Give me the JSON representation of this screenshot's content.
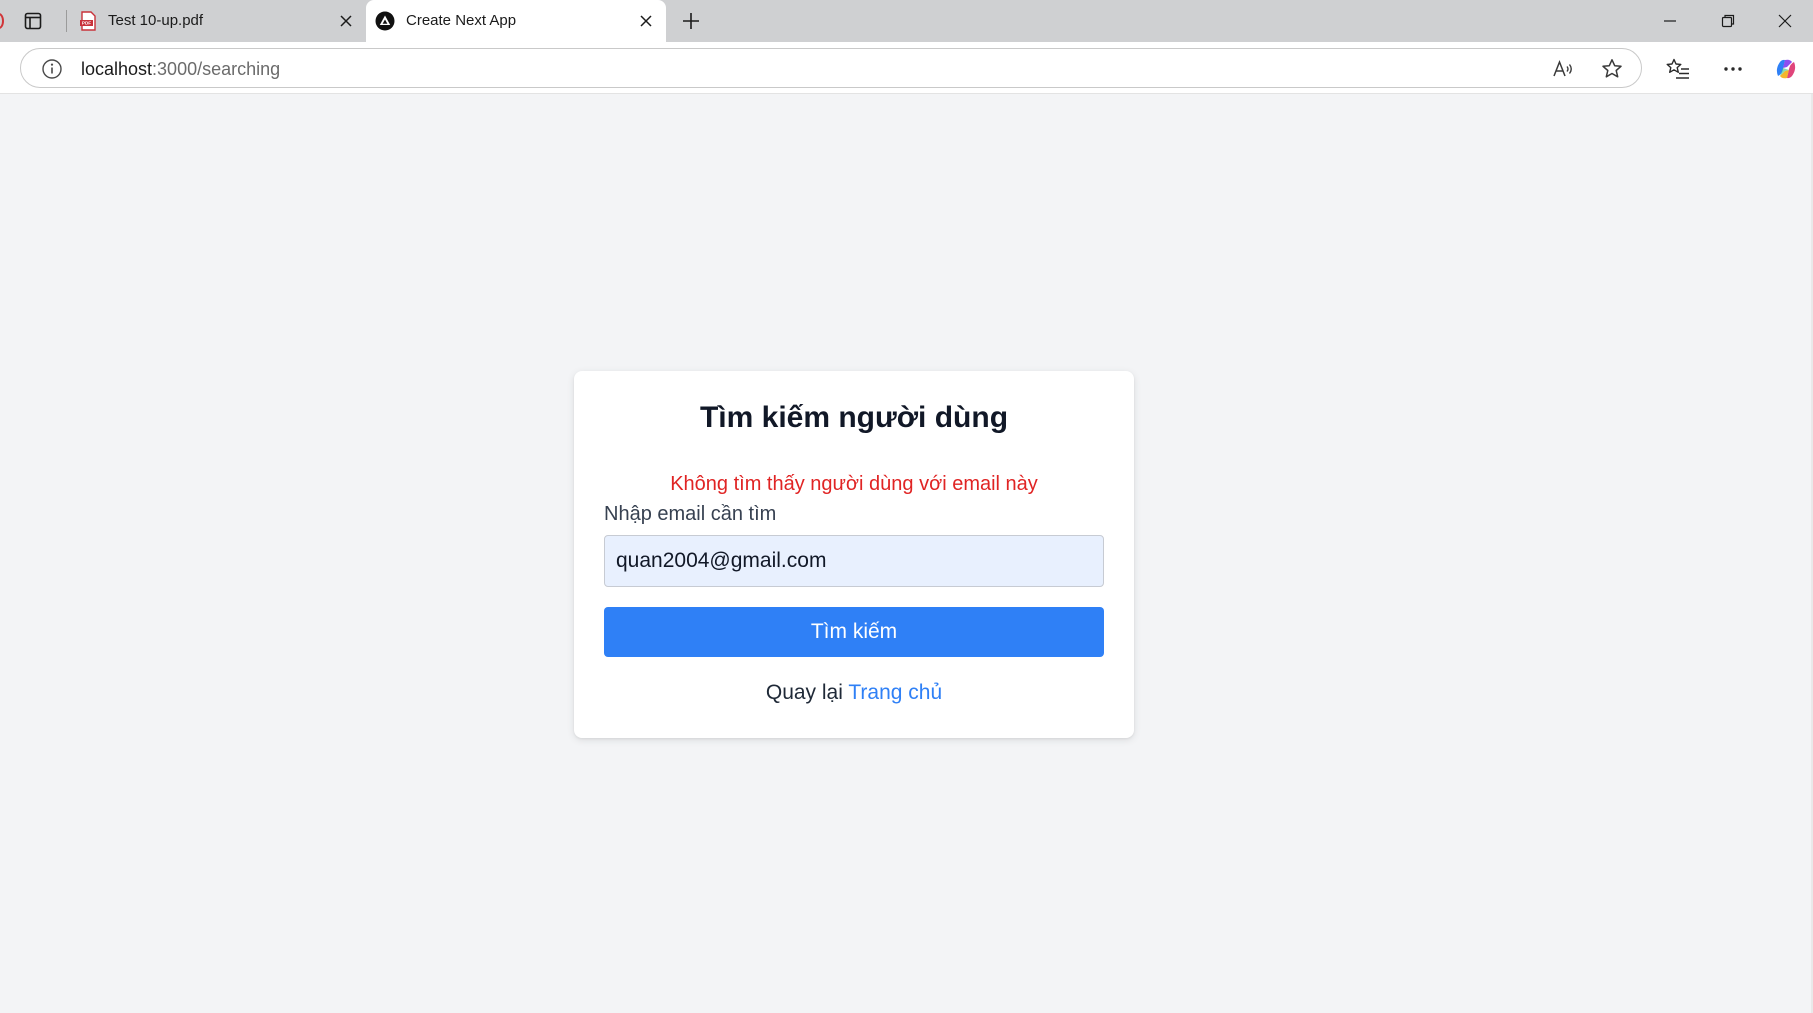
{
  "browser": {
    "tabs": [
      {
        "title": "Test 10-up.pdf",
        "icon": "pdf-icon",
        "active": false
      },
      {
        "title": "Create Next App",
        "icon": "nextjs-icon",
        "active": true
      }
    ],
    "address": {
      "host": "localhost",
      "rest": ":3000/searching"
    }
  },
  "page": {
    "title": "Tìm kiếm người dùng",
    "error": "Không tìm thấy người dùng với email này",
    "email_label": "Nhập email cần tìm",
    "email_value": "quan2004@gmail.com",
    "search_button": "Tìm kiếm",
    "back_text": "Quay lại ",
    "back_link": "Trang chủ"
  },
  "colors": {
    "primary": "#2f80f6",
    "error": "#e02424",
    "page_bg": "#f3f4f6",
    "input_bg": "#e8f0fe"
  }
}
